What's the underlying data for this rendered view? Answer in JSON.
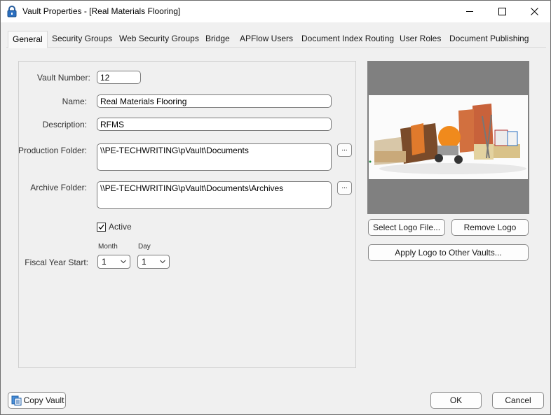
{
  "window": {
    "title": "Vault Properties - [Real Materials Flooring]",
    "icon": "lock-icon"
  },
  "tabs": [
    {
      "label": "General",
      "active": true
    },
    {
      "label": "Security Groups"
    },
    {
      "label": "Web Security Groups"
    },
    {
      "label": "Bridge"
    },
    {
      "label": "APFlow Users"
    },
    {
      "label": "Document Index Routing"
    },
    {
      "label": "User Roles"
    },
    {
      "label": "Document Publishing"
    }
  ],
  "general": {
    "vault_number_label": "Vault Number:",
    "vault_number": "12",
    "name_label": "Name:",
    "name": "Real Materials Flooring",
    "description_label": "Description:",
    "description": "RFMS",
    "production_folder_label": "Production Folder:",
    "production_folder": "\\\\PE-TECHWRITING\\pVault\\Documents",
    "archive_folder_label": "Archive Folder:",
    "archive_folder": "\\\\PE-TECHWRITING\\pVault\\Documents\\Archives",
    "browse_label": "...",
    "active_label": "Active",
    "active_checked": true,
    "fiscal_year_label": "Fiscal Year Start:",
    "month_label": "Month",
    "day_label": "Day",
    "month_value": "1",
    "day_value": "1"
  },
  "logo": {
    "select_button": "Select Logo File...",
    "remove_button": "Remove Logo",
    "apply_button": "Apply Logo to Other Vaults..."
  },
  "footer": {
    "copy_vault": "Copy Vault",
    "ok": "OK",
    "cancel": "Cancel"
  },
  "colors": {
    "accent": "#0078d7",
    "logo_frame": "#808080"
  }
}
